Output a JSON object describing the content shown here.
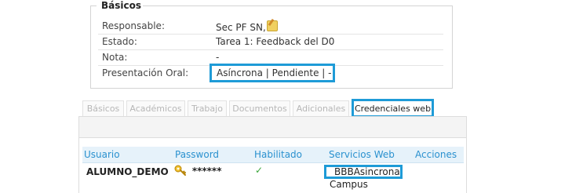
{
  "basicos": {
    "legend": "Básicos",
    "rows": [
      {
        "label": "Responsable:",
        "value": "Sec PF SN,"
      },
      {
        "label": "Estado:",
        "value": "Tarea 1: Feedback del D0"
      },
      {
        "label": "Nota:",
        "value": "-"
      },
      {
        "label": "Presentación Oral:",
        "value": "Asíncrona | Pendiente | -"
      }
    ]
  },
  "tabs": [
    {
      "label": "Básicos"
    },
    {
      "label": "Académicos"
    },
    {
      "label": "Trabajo"
    },
    {
      "label": "Documentos"
    },
    {
      "label": "Adicionales"
    },
    {
      "label": "Credenciales web"
    }
  ],
  "table": {
    "headers": [
      "Usuario",
      "Password",
      "Habilitado",
      "Servicios Web",
      "Acciones"
    ],
    "rows": [
      {
        "usuario": "ALUMNO_DEMO",
        "password": "******",
        "habilitado": "✓",
        "servicios_line1": "_BBBAsincrona,",
        "servicios_line2": "Campus",
        "acciones": ""
      }
    ]
  },
  "colors": {
    "highlight": "#1e9bd7",
    "header_text": "#2a91cf"
  }
}
